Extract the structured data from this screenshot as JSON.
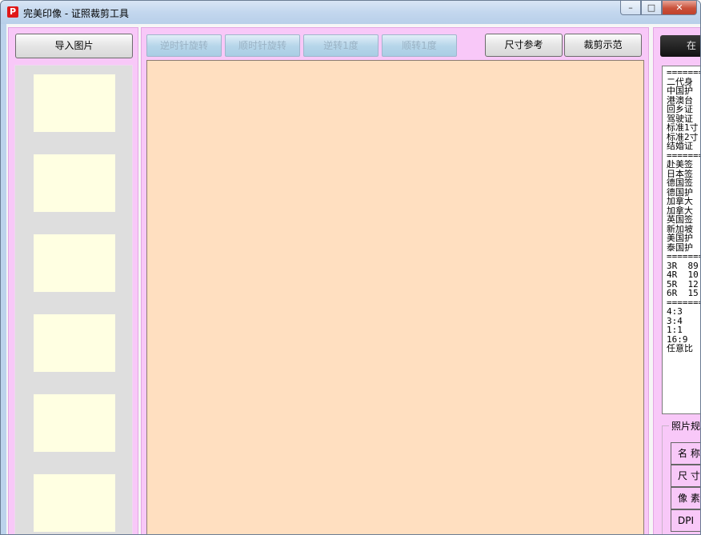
{
  "window": {
    "title": "完美印像 - 证照裁剪工具",
    "app_icon_letter": "P",
    "controls": {
      "minimize": "–",
      "maximize": "□",
      "close": "✕"
    }
  },
  "left_panel": {
    "import_button": "导入图片",
    "thumbnail_count": 6
  },
  "toolbar": {
    "rotate_ccw": "逆时针旋转",
    "rotate_cw": "顺时针旋转",
    "rotate_ccw_1deg": "逆转1度",
    "rotate_cw_1deg": "顺转1度",
    "size_reference": "尺寸参考",
    "crop_demo": "裁剪示范"
  },
  "right_panel": {
    "top_button": "在",
    "spec_list": [
      "=========",
      "二代身",
      "中国护",
      "港澳台",
      "回乡证",
      "驾驶证",
      "标准1寸",
      "标准2寸",
      "结婚证",
      "=========",
      "赴美签",
      "日本签",
      "德国签",
      "德国护",
      "加拿大",
      "加拿大",
      "英国签",
      "新加坡",
      "美国护",
      "泰国护",
      "=========",
      "3R  89",
      "4R  10",
      "5R  12",
      "6R  15",
      "=========",
      "4:3",
      "3:4",
      "1:1",
      "16:9",
      "任意比"
    ],
    "photo_group": {
      "title": "照片规",
      "rows": [
        "名 称",
        "尺 寸",
        "像 素",
        "DPI"
      ]
    }
  }
}
